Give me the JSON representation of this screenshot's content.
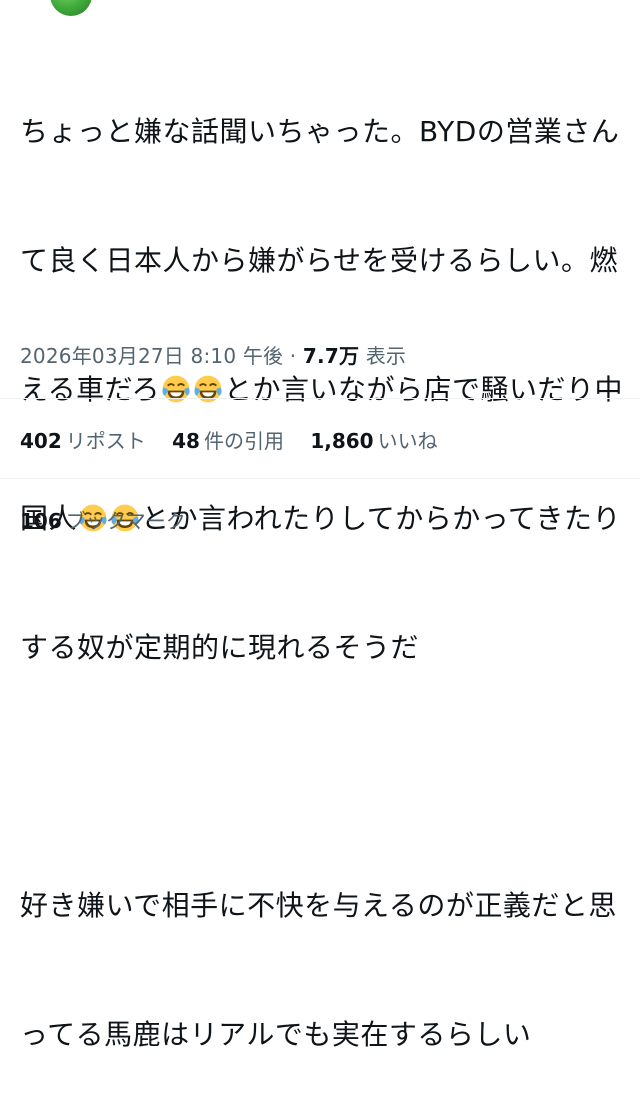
{
  "tweet": {
    "lines": [
      "ちょっと嫌な話聞いちゃった。BYDの営業さん",
      "て良く日本人から嫌がらせを受けるらしい。燃",
      "える車だろ",
      "とか言いながら店で騒いだり中",
      "国人",
      "とか言われたりしてからかってきたり",
      "する奴が定期的に現れるそうだ",
      "好き嫌いで相手に不快を与えるのが正義だと思",
      "ってる馬鹿はリアルでも実在するらしい"
    ],
    "emoji_name": "face-with-tears-of-joy-icon"
  },
  "meta": {
    "timestamp": "2026年03月27日 8:10 午後",
    "separator": "·",
    "views_count": "7.7万",
    "views_label": "表示"
  },
  "stats": {
    "reposts": {
      "count": "402",
      "label": "リポスト"
    },
    "quotes": {
      "count": "48",
      "label": "件の引用"
    },
    "likes": {
      "count": "1,860",
      "label": "いいね"
    },
    "bookmarks": {
      "count": "106",
      "label": "ブックマーク"
    }
  },
  "colors": {
    "text": "#0f1419",
    "secondary": "#536471",
    "divider": "#eff3f4",
    "avatar": "#3ea83a"
  }
}
